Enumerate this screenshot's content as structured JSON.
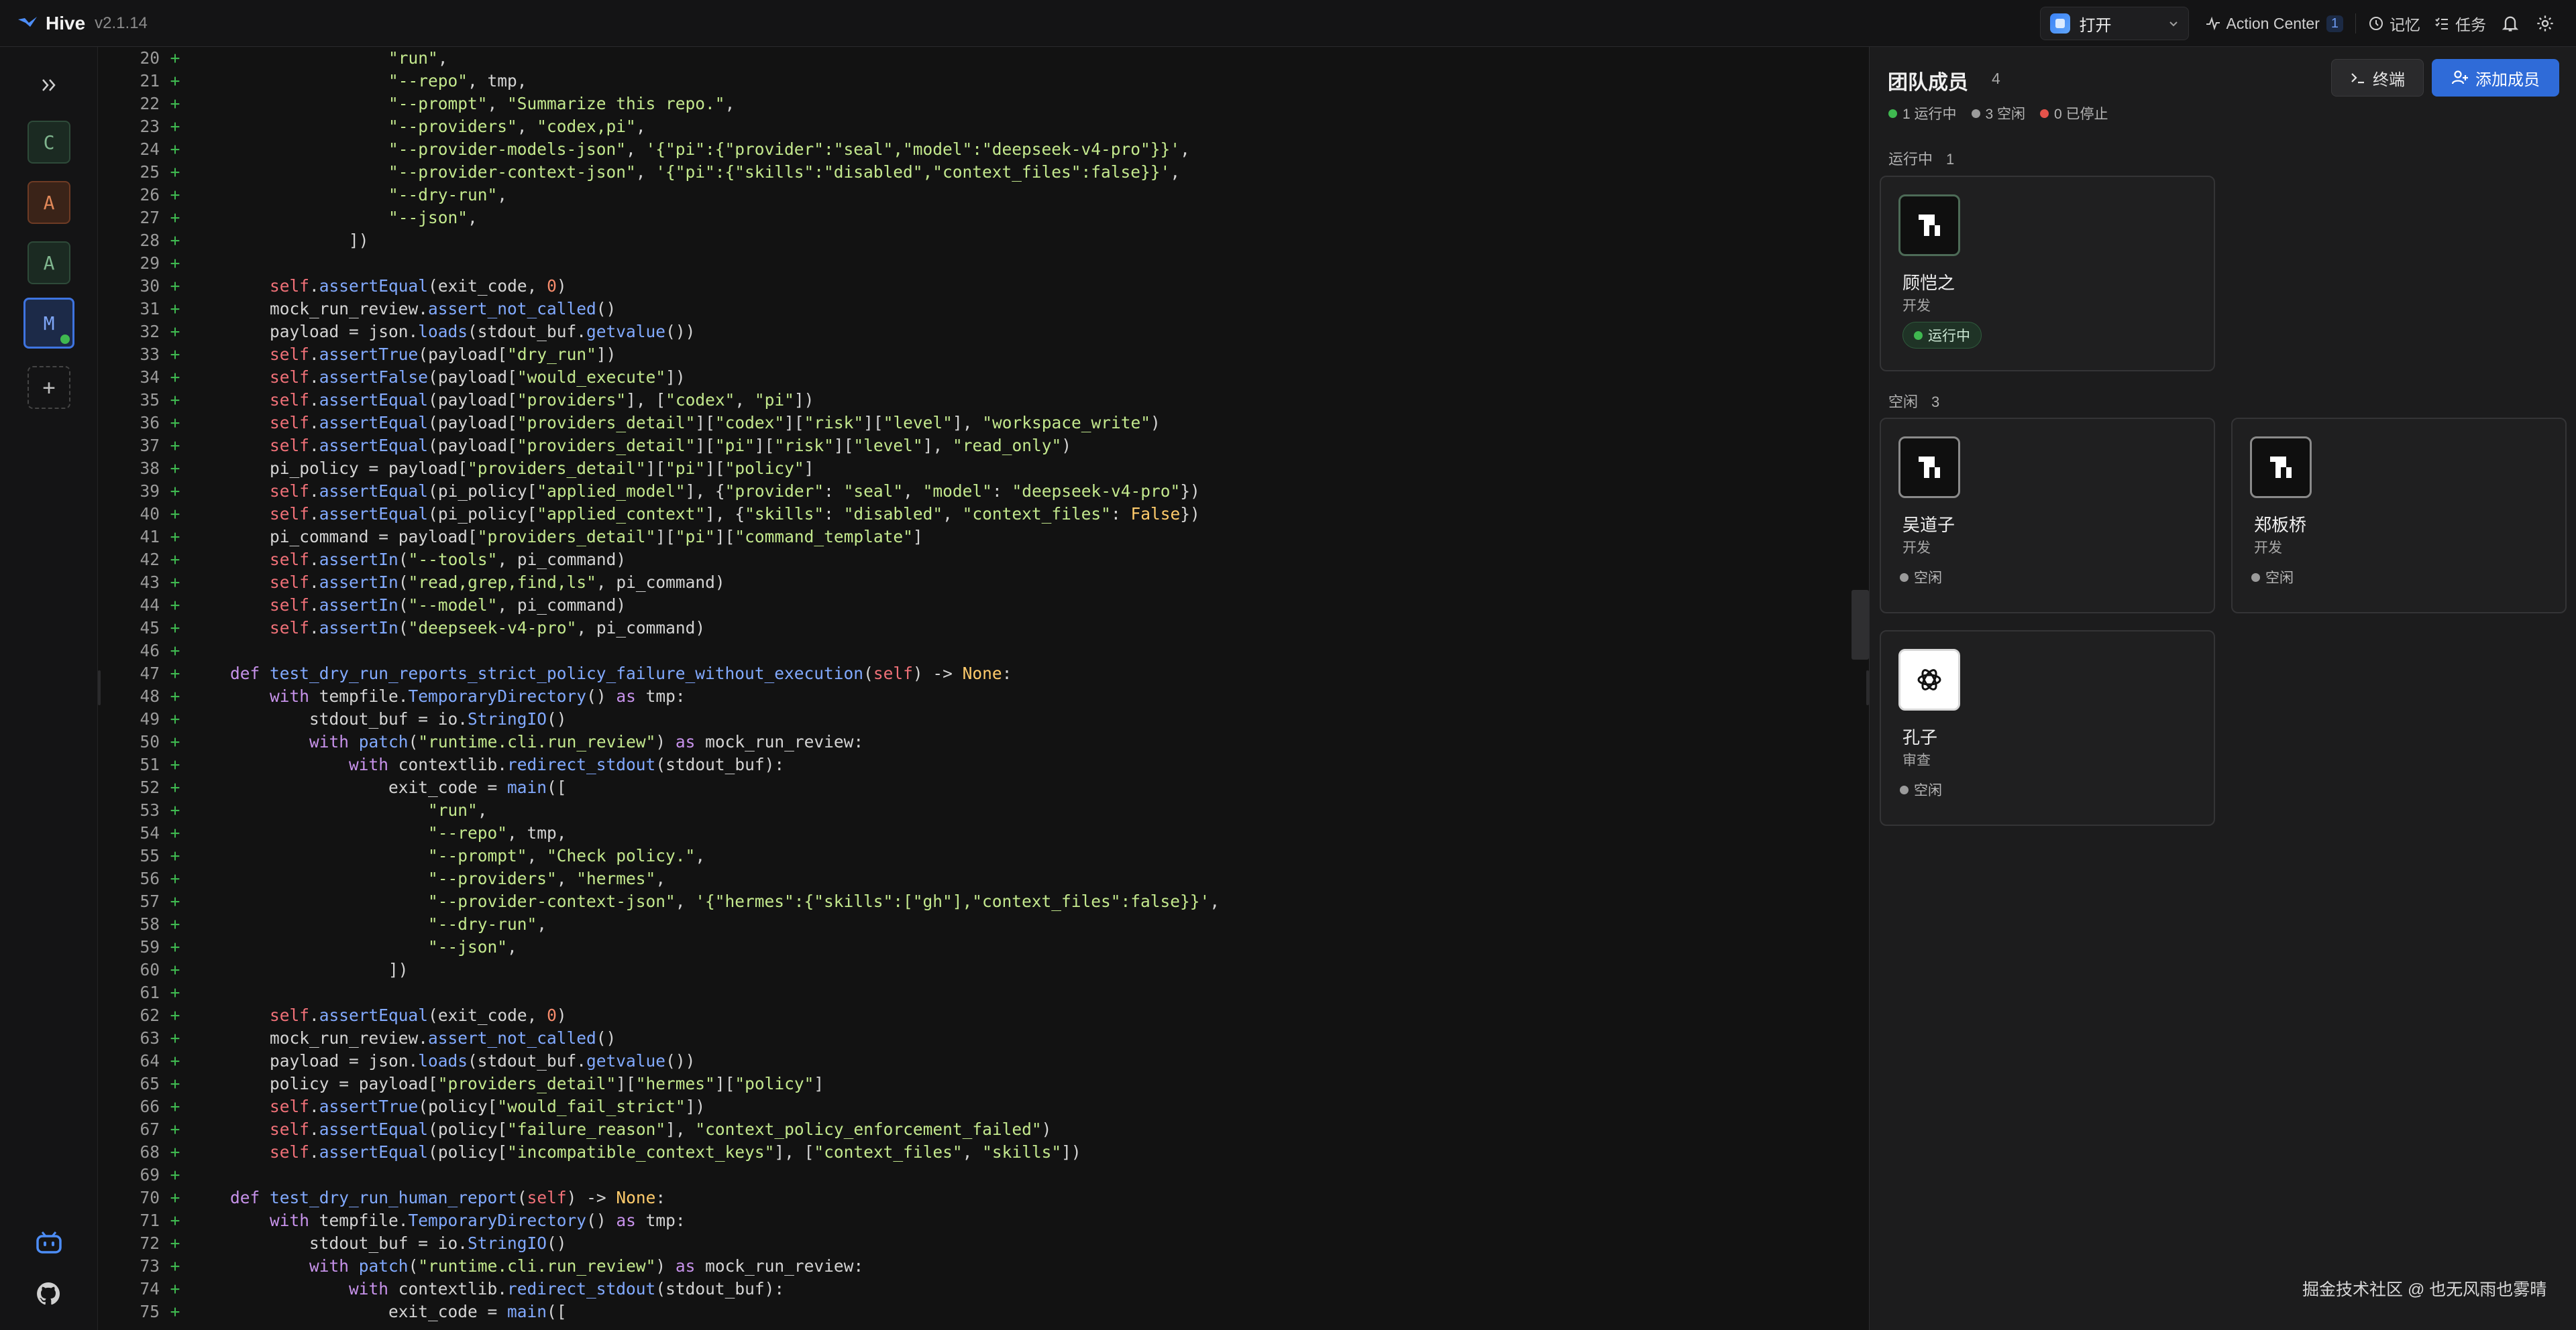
{
  "app": {
    "name": "Hive",
    "version": "v2.1.14"
  },
  "topbar": {
    "open_label": "打开",
    "action_center_label": "Action Center",
    "action_center_count": "1",
    "memory_label": "记忆",
    "tasks_label": "任务",
    "icons": [
      "pulse-icon",
      "memory-icon",
      "tasks-icon",
      "bell-icon",
      "gear-icon"
    ]
  },
  "rail": {
    "workspaces": [
      {
        "letter": "C",
        "color": "#7fb58e"
      },
      {
        "letter": "A",
        "color": "#e08758"
      },
      {
        "letter": "A",
        "color": "#7fb58e"
      },
      {
        "letter": "M",
        "color": "#7ea6f7",
        "active": true
      }
    ],
    "add_symbol": "+"
  },
  "code": {
    "lines": [
      {
        "n": "20",
        "t": "                    \"run\","
      },
      {
        "n": "21",
        "t": "                    \"--repo\", tmp,"
      },
      {
        "n": "22",
        "t": "                    \"--prompt\", \"Summarize this repo.\","
      },
      {
        "n": "23",
        "t": "                    \"--providers\", \"codex,pi\","
      },
      {
        "n": "24",
        "t": "                    \"--provider-models-json\", '{\"pi\":{\"provider\":\"seal\",\"model\":\"deepseek-v4-pro\"}}',"
      },
      {
        "n": "25",
        "t": "                    \"--provider-context-json\", '{\"pi\":{\"skills\":\"disabled\",\"context_files\":false}}',"
      },
      {
        "n": "26",
        "t": "                    \"--dry-run\","
      },
      {
        "n": "27",
        "t": "                    \"--json\","
      },
      {
        "n": "28",
        "t": "                ])"
      },
      {
        "n": "29",
        "t": ""
      },
      {
        "n": "30",
        "t": "        self.assertEqual(exit_code, 0)"
      },
      {
        "n": "31",
        "t": "        mock_run_review.assert_not_called()"
      },
      {
        "n": "32",
        "t": "        payload = json.loads(stdout_buf.getvalue())"
      },
      {
        "n": "33",
        "t": "        self.assertTrue(payload[\"dry_run\"])"
      },
      {
        "n": "34",
        "t": "        self.assertFalse(payload[\"would_execute\"])"
      },
      {
        "n": "35",
        "t": "        self.assertEqual(payload[\"providers\"], [\"codex\", \"pi\"])"
      },
      {
        "n": "36",
        "t": "        self.assertEqual(payload[\"providers_detail\"][\"codex\"][\"risk\"][\"level\"], \"workspace_write\")"
      },
      {
        "n": "37",
        "t": "        self.assertEqual(payload[\"providers_detail\"][\"pi\"][\"risk\"][\"level\"], \"read_only\")"
      },
      {
        "n": "38",
        "t": "        pi_policy = payload[\"providers_detail\"][\"pi\"][\"policy\"]"
      },
      {
        "n": "39",
        "t": "        self.assertEqual(pi_policy[\"applied_model\"], {\"provider\": \"seal\", \"model\": \"deepseek-v4-pro\"})"
      },
      {
        "n": "40",
        "t": "        self.assertEqual(pi_policy[\"applied_context\"], {\"skills\": \"disabled\", \"context_files\": False})"
      },
      {
        "n": "41",
        "t": "        pi_command = payload[\"providers_detail\"][\"pi\"][\"command_template\"]"
      },
      {
        "n": "42",
        "t": "        self.assertIn(\"--tools\", pi_command)"
      },
      {
        "n": "43",
        "t": "        self.assertIn(\"read,grep,find,ls\", pi_command)"
      },
      {
        "n": "44",
        "t": "        self.assertIn(\"--model\", pi_command)"
      },
      {
        "n": "45",
        "t": "        self.assertIn(\"deepseek-v4-pro\", pi_command)"
      },
      {
        "n": "46",
        "t": ""
      },
      {
        "n": "47",
        "t": "    def test_dry_run_reports_strict_policy_failure_without_execution(self) -> None:"
      },
      {
        "n": "48",
        "t": "        with tempfile.TemporaryDirectory() as tmp:"
      },
      {
        "n": "49",
        "t": "            stdout_buf = io.StringIO()"
      },
      {
        "n": "50",
        "t": "            with patch(\"runtime.cli.run_review\") as mock_run_review:"
      },
      {
        "n": "51",
        "t": "                with contextlib.redirect_stdout(stdout_buf):"
      },
      {
        "n": "52",
        "t": "                    exit_code = main(["
      },
      {
        "n": "53",
        "t": "                        \"run\","
      },
      {
        "n": "54",
        "t": "                        \"--repo\", tmp,"
      },
      {
        "n": "55",
        "t": "                        \"--prompt\", \"Check policy.\","
      },
      {
        "n": "56",
        "t": "                        \"--providers\", \"hermes\","
      },
      {
        "n": "57",
        "t": "                        \"--provider-context-json\", '{\"hermes\":{\"skills\":[\"gh\"],\"context_files\":false}}',"
      },
      {
        "n": "58",
        "t": "                        \"--dry-run\","
      },
      {
        "n": "59",
        "t": "                        \"--json\","
      },
      {
        "n": "60",
        "t": "                    ])"
      },
      {
        "n": "61",
        "t": ""
      },
      {
        "n": "62",
        "t": "        self.assertEqual(exit_code, 0)"
      },
      {
        "n": "63",
        "t": "        mock_run_review.assert_not_called()"
      },
      {
        "n": "64",
        "t": "        payload = json.loads(stdout_buf.getvalue())"
      },
      {
        "n": "65",
        "t": "        policy = payload[\"providers_detail\"][\"hermes\"][\"policy\"]"
      },
      {
        "n": "66",
        "t": "        self.assertTrue(policy[\"would_fail_strict\"])"
      },
      {
        "n": "67",
        "t": "        self.assertEqual(policy[\"failure_reason\"], \"context_policy_enforcement_failed\")"
      },
      {
        "n": "68",
        "t": "        self.assertEqual(policy[\"incompatible_context_keys\"], [\"context_files\", \"skills\"])"
      },
      {
        "n": "69",
        "t": ""
      },
      {
        "n": "70",
        "t": "    def test_dry_run_human_report(self) -> None:"
      },
      {
        "n": "71",
        "t": "        with tempfile.TemporaryDirectory() as tmp:"
      },
      {
        "n": "72",
        "t": "            stdout_buf = io.StringIO()"
      },
      {
        "n": "73",
        "t": "            with patch(\"runtime.cli.run_review\") as mock_run_review:"
      },
      {
        "n": "74",
        "t": "                with contextlib.redirect_stdout(stdout_buf):"
      },
      {
        "n": "75",
        "t": "                    exit_code = main(["
      }
    ]
  },
  "team": {
    "title": "团队成员",
    "count": "4",
    "terminal_label": "终端",
    "add_member_label": "添加成员",
    "stats": {
      "running": "1 运行中",
      "idle": "3 空闲",
      "stopped": "0 已停止"
    },
    "sections": {
      "running_label": "运行中",
      "running_count": "1",
      "idle_label": "空闲",
      "idle_count": "3"
    },
    "members": [
      {
        "name": "顾恺之",
        "role": "开发",
        "status": "运行中",
        "icon": "pi-logo-icon"
      },
      {
        "name": "吴道子",
        "role": "开发",
        "status": "空闲",
        "icon": "pi-logo-icon"
      },
      {
        "name": "郑板桥",
        "role": "开发",
        "status": "空闲",
        "icon": "pi-logo-icon"
      },
      {
        "name": "孔子",
        "role": "审查",
        "status": "空闲",
        "icon": "openai-logo-icon"
      }
    ]
  },
  "watermark": "掘金技术社区 @ 也无风雨也雾晴"
}
